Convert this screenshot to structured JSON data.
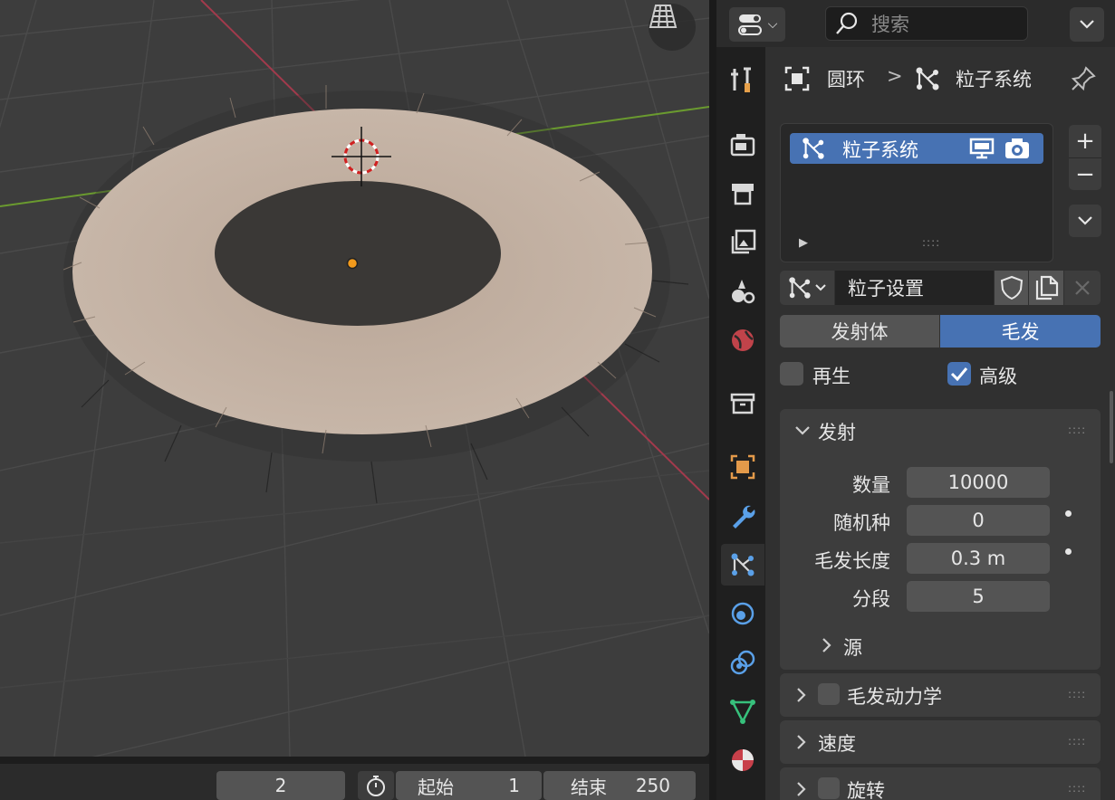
{
  "header": {
    "search_placeholder": "搜索"
  },
  "breadcrumb": {
    "object": "圆环",
    "separator": ">",
    "data": "粒子系统"
  },
  "particle_list": {
    "items": [
      {
        "name": "粒子系统"
      }
    ]
  },
  "settings": {
    "name": "粒子设置"
  },
  "type_tabs": {
    "emitter": "发射体",
    "hair": "毛发",
    "active": "hair"
  },
  "options": {
    "regrow": {
      "label": "再生",
      "checked": false
    },
    "advanced": {
      "label": "高级",
      "checked": true
    }
  },
  "emission": {
    "title": "发射",
    "fields": [
      {
        "label": "数量",
        "value": "10000"
      },
      {
        "label": "随机种",
        "value": "0"
      },
      {
        "label": "毛发长度",
        "value": "0.3 m"
      },
      {
        "label": "分段",
        "value": "5"
      }
    ],
    "source": "源"
  },
  "panels": [
    {
      "label": "毛发动力学",
      "checkbox": true
    },
    {
      "label": "速度",
      "checkbox": false
    },
    {
      "label": "旋转",
      "checkbox": true
    }
  ],
  "timeline": {
    "current_frame": "2",
    "start_label": "起始",
    "start_value": "1",
    "end_label": "结束",
    "end_value": "250"
  },
  "colors": {
    "accent": "#4772b3",
    "x_axis": "#a23a4c",
    "y_axis": "#6a9a2f",
    "active_tab": "#303030"
  }
}
